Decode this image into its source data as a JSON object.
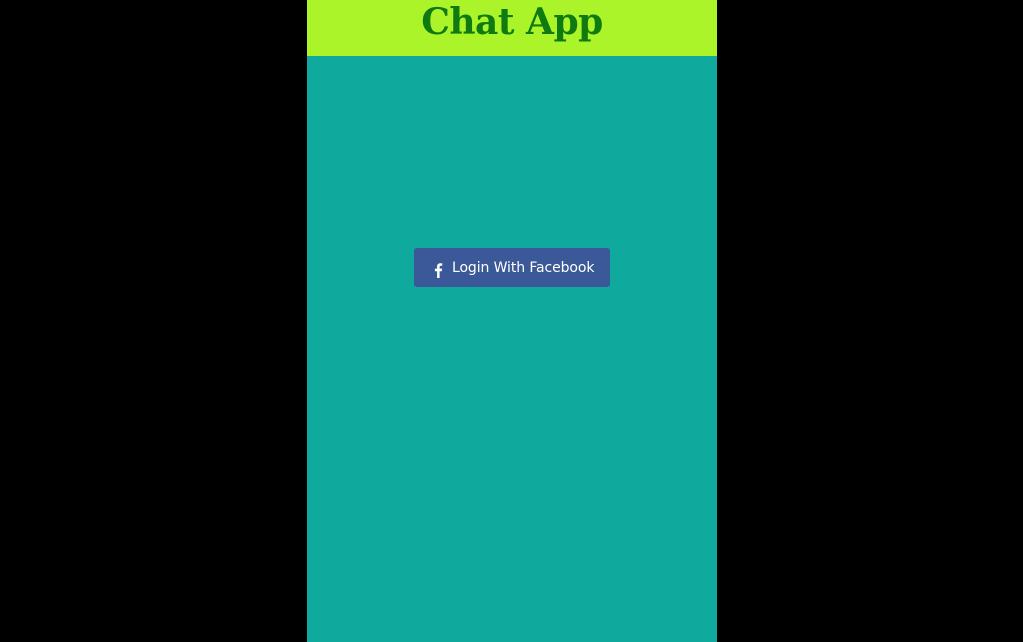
{
  "header": {
    "title": "Chat App"
  },
  "login": {
    "button_label": "Login With Facebook",
    "icon": "facebook-icon"
  },
  "colors": {
    "page_background": "#000000",
    "header_background": "#abf42a",
    "title_color": "#0f7a0f",
    "app_background": "#10a99d",
    "facebook_button": "#3b5998",
    "button_text": "#ffffff"
  }
}
